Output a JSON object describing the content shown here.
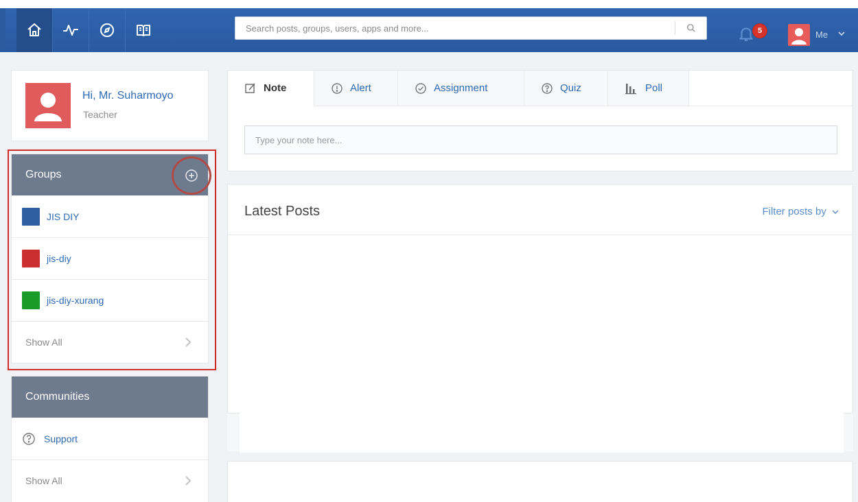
{
  "nav": {
    "items": [
      {
        "name": "home-icon"
      },
      {
        "name": "activity-icon"
      },
      {
        "name": "discover-icon"
      },
      {
        "name": "book-icon"
      }
    ],
    "search_placeholder": "Search posts, groups, users, apps and more...",
    "notifications_count": "5",
    "me_label": "Me"
  },
  "profile": {
    "greeting": "Hi, Mr. Suharmoyo",
    "role": "Teacher"
  },
  "groups": {
    "title": "Groups",
    "items": [
      {
        "label": "JIS DIY",
        "color": "#2f5f9e"
      },
      {
        "label": "jis-diy",
        "color": "#cc2f2f"
      },
      {
        "label": "jis-diy-xurang",
        "color": "#1a9a28"
      }
    ],
    "show_all": "Show All"
  },
  "communities": {
    "title": "Communities",
    "items": [
      {
        "label": "Support",
        "icon": "help-circle-icon"
      }
    ],
    "show_all": "Show All"
  },
  "composer": {
    "tabs": [
      {
        "label": "Note",
        "icon": "edit-icon",
        "active": true
      },
      {
        "label": "Alert",
        "icon": "alert-icon"
      },
      {
        "label": "Assignment",
        "icon": "check-circle-icon"
      },
      {
        "label": "Quiz",
        "icon": "help-circle-icon"
      },
      {
        "label": "Poll",
        "icon": "bar-chart-icon"
      }
    ],
    "note_placeholder": "Type your note here..."
  },
  "posts": {
    "title": "Latest Posts",
    "filter_label": "Filter posts by"
  },
  "colors": {
    "nav_bg": "#2a5aa0",
    "panel_header_bg": "#6e7b8f",
    "link_blue": "#2d6ab4",
    "highlight_red": "#d02b2b",
    "badge_red": "#d7332a"
  }
}
